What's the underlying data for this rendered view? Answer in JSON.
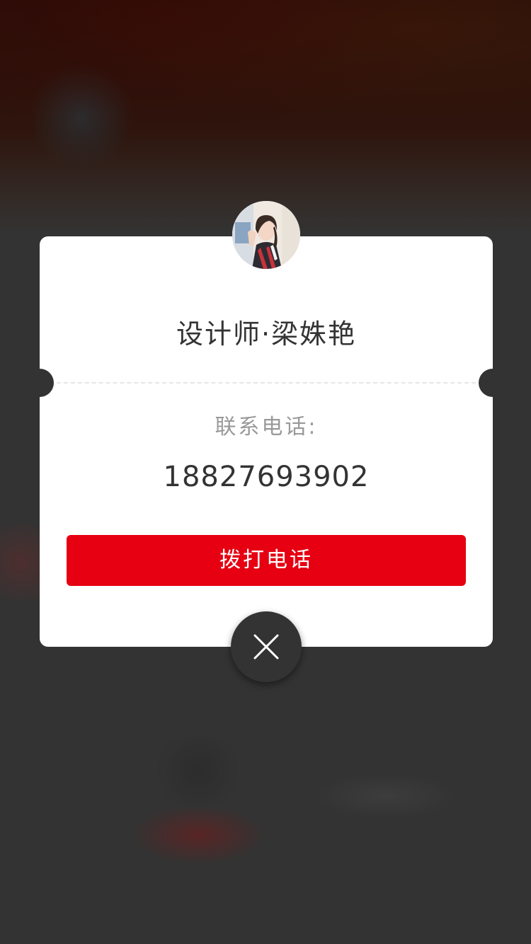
{
  "colors": {
    "accent": "#e60012",
    "overlay": "#333333",
    "card": "#ffffff",
    "title_text": "#333333",
    "label_text": "#999999"
  },
  "contact_card": {
    "title": "设计师·梁姝艳",
    "phone_label": "联系电话:",
    "phone_number": "18827693902",
    "call_button_label": "拨打电话"
  },
  "icons": {
    "avatar": "designer-avatar-photo",
    "close": "close-icon"
  }
}
